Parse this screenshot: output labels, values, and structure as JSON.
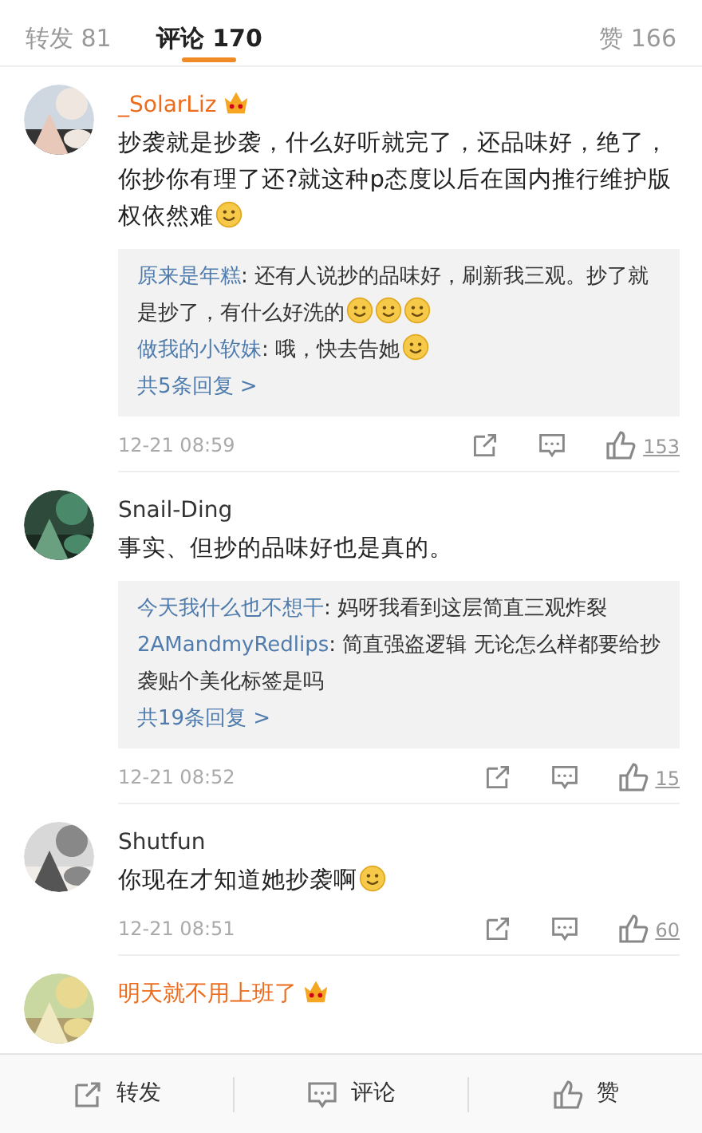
{
  "tabs": [
    {
      "label": "转发 81",
      "selected": false
    },
    {
      "label": "评论 170",
      "selected": true
    },
    {
      "label": "赞 166",
      "selected": false
    }
  ],
  "comments": [
    {
      "avatar": {
        "kind": "picture"
      },
      "user": "_SolarLiz",
      "vip": true,
      "body": [
        {
          "kind": "text",
          "text": "抄袭就是抄袭，什么好听就完了，还品味好，绝了，你抄你有理了还?就这种p态度以后在国内推行维护版权依然难"
        },
        {
          "kind": "emoji"
        }
      ],
      "replies": [
        {
          "user": "原来是年糕",
          "body": [
            {
              "kind": "text",
              "text": ": 还有人说抄的品味好，刷新我三观。抄了就是抄了，有什么好洗的"
            },
            {
              "kind": "emoji"
            },
            {
              "kind": "emoji"
            },
            {
              "kind": "emoji"
            }
          ]
        },
        {
          "user": "做我的小软妹",
          "body": [
            {
              "kind": "text",
              "text": ": 哦，快去告她"
            },
            {
              "kind": "emoji"
            }
          ]
        }
      ],
      "more": "共5条回复 >",
      "time": "12-21 08:59",
      "likes": "153"
    },
    {
      "avatar": {
        "kind": "picture"
      },
      "user": "Snail-Ding",
      "vip": false,
      "body": [
        {
          "kind": "text",
          "text": "事实、但抄的品味好也是真的。"
        }
      ],
      "replies": [
        {
          "user": "今天我什么也不想干",
          "body": [
            {
              "kind": "text",
              "text": ": 妈呀我看到这层简直三观炸裂"
            }
          ]
        },
        {
          "user": "2AMandmyRedlips",
          "body": [
            {
              "kind": "text",
              "text": ": 简直强盗逻辑 无论怎么样都要给抄袭贴个美化标签是吗"
            }
          ]
        }
      ],
      "more": "共19条回复 >",
      "time": "12-21 08:52",
      "likes": "15"
    },
    {
      "avatar": {
        "kind": "picture"
      },
      "user": "Shutfun",
      "vip": false,
      "body": [
        {
          "kind": "text",
          "text": "你现在才知道她抄袭啊"
        },
        {
          "kind": "emoji"
        }
      ],
      "time": "12-21 08:51",
      "likes": "60"
    },
    {
      "avatar": {
        "kind": "picture"
      },
      "user": "明天就不用上班了",
      "vip": true
    }
  ],
  "bottom_bar": [
    {
      "kind": "share",
      "label": "转发"
    },
    {
      "kind": "comment",
      "label": "评论"
    },
    {
      "kind": "like",
      "label": "赞"
    }
  ]
}
